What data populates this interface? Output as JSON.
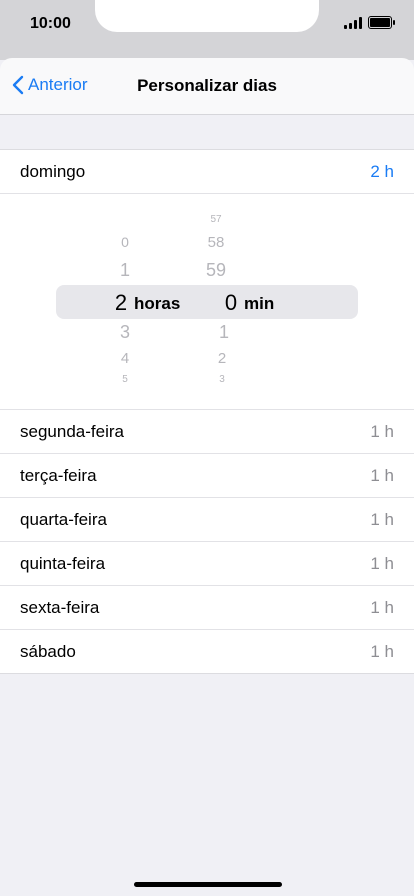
{
  "status_bar": {
    "time": "10:00"
  },
  "nav": {
    "back_label": "Anterior",
    "title": "Personalizar dias"
  },
  "days": [
    {
      "label": "domingo",
      "value": "2 h"
    },
    {
      "label": "segunda-feira",
      "value": "1 h"
    },
    {
      "label": "terça-feira",
      "value": "1 h"
    },
    {
      "label": "quarta-feira",
      "value": "1 h"
    },
    {
      "label": "quinta-feira",
      "value": "1 h"
    },
    {
      "label": "sexta-feira",
      "value": "1 h"
    },
    {
      "label": "sábado",
      "value": "1 h"
    }
  ],
  "picker": {
    "hours": {
      "above": [
        "0",
        "1"
      ],
      "selected": "2",
      "below": [
        "3",
        "4",
        "5"
      ],
      "unit": "horas"
    },
    "minutes": {
      "above": [
        "57",
        "58",
        "59"
      ],
      "selected": "0",
      "below": [
        "1",
        "2",
        "3"
      ],
      "unit": "min"
    }
  },
  "colors": {
    "accent": "#1a7cf4",
    "background": "#f0f0f5"
  }
}
